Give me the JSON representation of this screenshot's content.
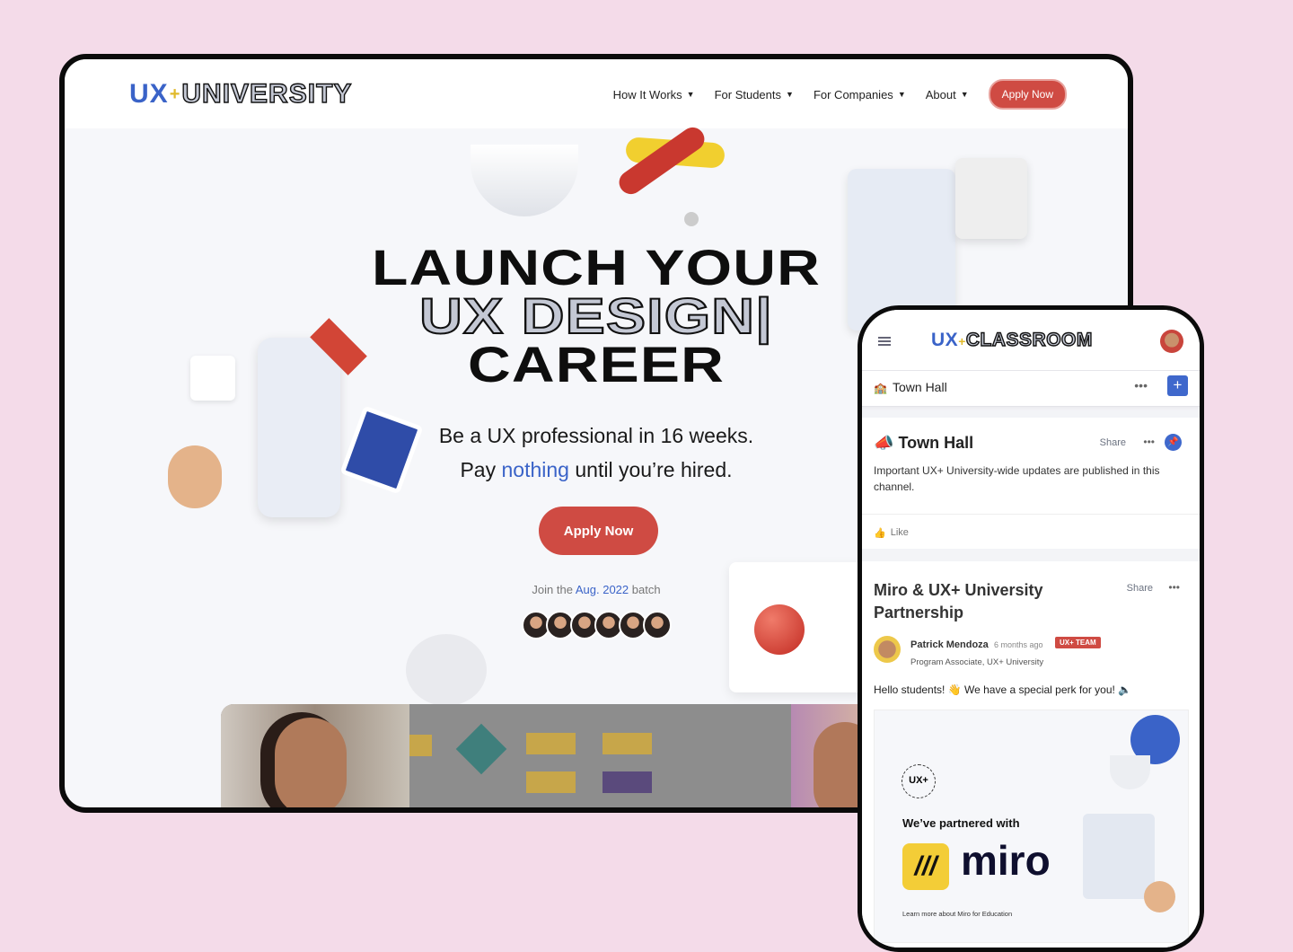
{
  "desktop": {
    "logo": {
      "prefix": "UX",
      "plus": "+",
      "word": "UNIVERSITY"
    },
    "nav": [
      {
        "label": "How It Works"
      },
      {
        "label": "For Students"
      },
      {
        "label": "For Companies"
      },
      {
        "label": "About"
      }
    ],
    "nav_caret": "▼",
    "apply_small": "Apply Now",
    "headline": {
      "line1": "LAUNCH YOUR",
      "line2": "UX DESIGN|",
      "line3": "CAREER"
    },
    "sub": {
      "line1": "Be a UX professional in 16 weeks.",
      "pre": "Pay ",
      "highlight": "nothing",
      "post": " until you’re hired."
    },
    "apply_large": "Apply Now",
    "batch": {
      "pre": "Join the ",
      "highlight": "Aug. 2022",
      "post": " batch"
    },
    "avatar_count": 6,
    "colors": {
      "accent_red": "#cf4b43",
      "accent_blue": "#3a63c8",
      "background": "#f4dbe9"
    }
  },
  "phone": {
    "logo": {
      "prefix": "UX",
      "plus": "+",
      "word": "CLASSROOM"
    },
    "channel": {
      "icon": "🏫",
      "name": "Town Hall",
      "more": "•••",
      "add": "+"
    },
    "post1": {
      "icon": "📣",
      "title": "Town Hall",
      "share": "Share",
      "more": "•••",
      "body": "Important UX+ University-wide updates are published in this channel.",
      "like": "Like"
    },
    "post2": {
      "title": "Miro & UX+ University Partnership",
      "share": "Share",
      "more": "•••",
      "author": "Patrick Mendoza",
      "time": "6 months ago",
      "badge": "UX+ TEAM",
      "role": "Program Associate, UX+ University",
      "body": "Hello students! 👋 We have a special perk for you! 🔈",
      "banner": {
        "seal": "UX+",
        "partnered": "We’ve partnered with",
        "brand": "miro",
        "learn": "Learn more about Miro for Education"
      }
    }
  }
}
